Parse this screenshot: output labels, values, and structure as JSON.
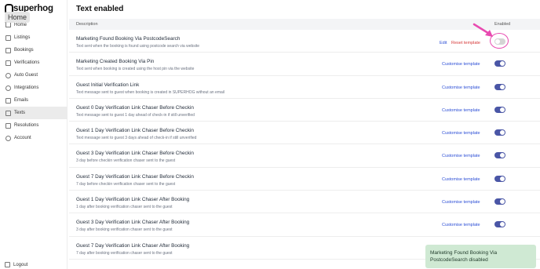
{
  "brand": {
    "name": "superhog"
  },
  "tooltip": {
    "label": "Home"
  },
  "sidebar": {
    "items": [
      {
        "label": "Home",
        "icon": "home-icon"
      },
      {
        "label": "Listings",
        "icon": "listings-icon"
      },
      {
        "label": "Bookings",
        "icon": "bookings-icon"
      },
      {
        "label": "Verifications",
        "icon": "verifications-icon"
      },
      {
        "label": "Auto Guest",
        "icon": "auto-guest-icon"
      },
      {
        "label": "Integrations",
        "icon": "integrations-icon"
      },
      {
        "label": "Emails",
        "icon": "emails-icon"
      },
      {
        "label": "Texts",
        "icon": "texts-icon",
        "active": true
      },
      {
        "label": "Resolutions",
        "icon": "resolutions-icon"
      },
      {
        "label": "Account",
        "icon": "account-icon"
      }
    ],
    "logout": "Logout"
  },
  "page": {
    "title": "Text enabled"
  },
  "table": {
    "col_description": "Description",
    "col_enabled": "Enabled",
    "rows": [
      {
        "title": "Marketing Found Booking Via PostcodeSearch",
        "subtitle": "Text sent when the booking is found using postcode search via website",
        "enabled": false,
        "edit": "Edit",
        "reset": "Reset template"
      },
      {
        "title": "Marketing Created Booking Via Pin",
        "subtitle": "Text sent when booking is created using the host pin via the website",
        "enabled": true,
        "customise": "Customise template"
      },
      {
        "title": "Guest Initial Verification Link",
        "subtitle": "Text message sent to guest when booking is created in SUPERHOG without an email",
        "enabled": true,
        "customise": "Customise template"
      },
      {
        "title": "Guest 0 Day Verification Link Chaser Before Checkin",
        "subtitle": "Text message sent to guest 1 day ahead of check-in if still unverified",
        "enabled": true,
        "customise": "Customise template"
      },
      {
        "title": "Guest 1 Day Verification Link Chaser Before Checkin",
        "subtitle": "Text message sent to guest 3 days ahead of check-in if still unverified",
        "enabled": true,
        "customise": "Customise template"
      },
      {
        "title": "Guest 3 Day Verification Link Chaser Before Checkin",
        "subtitle": "3 day before checkin verification chaser sent to the guest",
        "enabled": true,
        "customise": "Customise template"
      },
      {
        "title": "Guest 7 Day Verification Link Chaser Before Checkin",
        "subtitle": "7 day before checkin verification chaser sent to the guest",
        "enabled": true,
        "customise": "Customise template"
      },
      {
        "title": "Guest 1 Day Verification Link Chaser After Booking",
        "subtitle": "1 day after booking verification chaser sent to the guest",
        "enabled": true,
        "customise": "Customise template"
      },
      {
        "title": "Guest 3 Day Verification Link Chaser After Booking",
        "subtitle": "3 day after booking verification chaser sent to the guest",
        "enabled": true,
        "customise": "Customise template"
      },
      {
        "title": "Guest 7 Day Verification Link Chaser After Booking",
        "subtitle": "7 day after booking verification chaser sent to the guest",
        "enabled": true,
        "customise": ""
      }
    ]
  },
  "toast": {
    "message": "Marketing Found Booking Via PostcodeSearch disabled"
  },
  "colors": {
    "accent": "#4a56a6",
    "link": "#2d4fd6",
    "danger": "#d63a3a",
    "annotation": "#e84ab0",
    "toast_bg": "#cfe9d3"
  }
}
